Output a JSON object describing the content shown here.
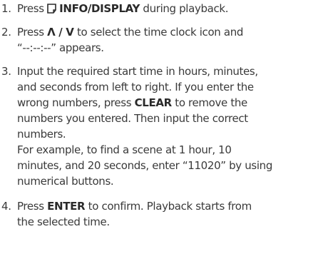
{
  "steps": [
    {
      "number": "1.",
      "press": "Press",
      "key": "INFO/DISPLAY",
      "rest": "during playback."
    },
    {
      "number": "2.",
      "press": "Press",
      "arrows": "Λ / V",
      "rest_line1": "to select the time clock icon and",
      "rest_line2": "“--:--:--” appears."
    },
    {
      "number": "3.",
      "line1": "Input the required start time in hours, minutes,",
      "line2": "and seconds from left to right. If you enter the",
      "line3_pre": "wrong numbers, press",
      "clear_key": "CLEAR",
      "line3_post": "to remove the",
      "line4": "numbers you entered. Then input the correct",
      "line5": "numbers.",
      "example_line1": "For example, to find a scene at 1 hour, 10",
      "example_line2": "minutes, and 20 seconds, enter “11020” by using",
      "example_line3": "numerical buttons."
    },
    {
      "number": "4.",
      "press": "Press",
      "key": "ENTER",
      "rest_line1": "to confirm. Playback starts from",
      "rest_line2": "the selected time."
    }
  ],
  "icons": {
    "info": "info-display-button-icon"
  }
}
